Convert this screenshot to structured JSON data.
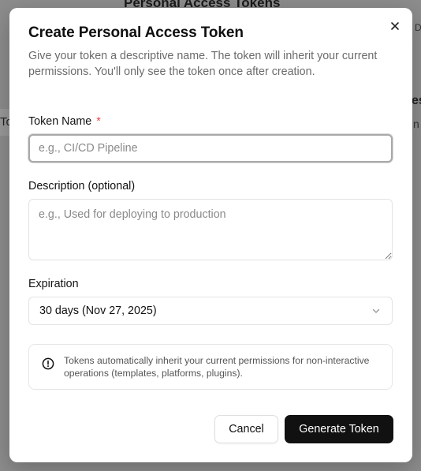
{
  "background": {
    "page_title": "Personal Access Tokens",
    "left_fragment": "To",
    "right_fragment_a": "es",
    "right_fragment_b": "n",
    "right_fragment_c": "D"
  },
  "dialog": {
    "title": "Create Personal Access Token",
    "subtitle": "Give your token a descriptive name. The token will inherit your current permissions. You'll only see the token once after creation.",
    "close_icon": "close-icon",
    "token_name": {
      "label": "Token Name",
      "required_mark": "*",
      "value": "",
      "placeholder": "e.g., CI/CD Pipeline"
    },
    "description": {
      "label": "Description (optional)",
      "value": "",
      "placeholder": "e.g., Used for deploying to production"
    },
    "expiration": {
      "label": "Expiration",
      "selected": "30 days (Nov 27, 2025)",
      "icon": "chevron-down-icon"
    },
    "info": {
      "icon": "info-circle-icon",
      "text": "Tokens automatically inherit your current permissions for non-interactive operations (templates, platforms, plugins)."
    },
    "buttons": {
      "cancel": "Cancel",
      "generate": "Generate Token"
    }
  },
  "colors": {
    "overlay": "#8d8d8d",
    "primary_button": "#111111",
    "required": "#e5484d"
  }
}
